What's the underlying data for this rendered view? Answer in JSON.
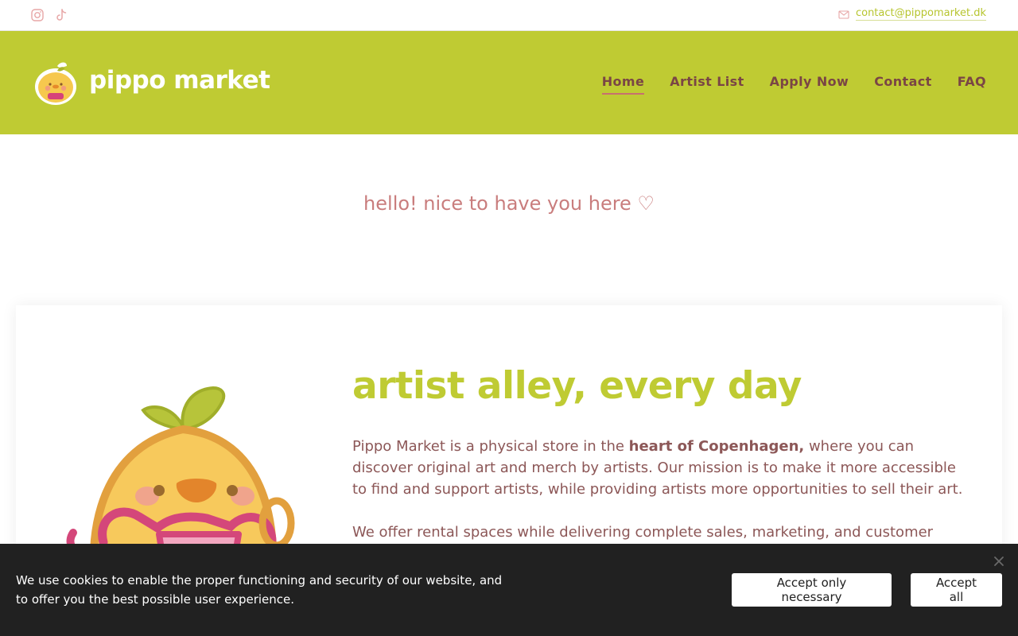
{
  "topbar": {
    "icons": [
      "instagram-icon",
      "tiktok-icon",
      "mail-icon"
    ],
    "email": "contact@pippomarket.dk"
  },
  "header": {
    "brand": "pippo market",
    "nav": [
      {
        "label": "Home",
        "active": true
      },
      {
        "label": "Artist List",
        "active": false
      },
      {
        "label": "Apply Now",
        "active": false
      },
      {
        "label": "Contact",
        "active": false
      },
      {
        "label": "FAQ",
        "active": false
      }
    ]
  },
  "greeting": "hello! nice to have you here ♡",
  "intro": {
    "title": "artist alley, every day",
    "p1_before": "Pippo Market is a physical store in the ",
    "p1_bold": "heart of Copenhagen,",
    "p1_after": " where you can discover original art and merch by artists. Our mission is to make it more accessible to find and support artists, while providing artists more opportunities to sell their art.",
    "p2": "We offer rental spaces while delivering complete sales, marketing, and customer support"
  },
  "cookie": {
    "text": "We use cookies to enable the proper functioning and security of our website, and to offer you the best possible user experience.",
    "accept_necessary": "Accept only necessary",
    "accept_all": "Accept all"
  },
  "colors": {
    "brand_green": "#bfcb33",
    "nav_text": "#7a4545",
    "greeting_pink": "#c97d7d",
    "body_text": "#8c5757",
    "cookie_bg": "#212121"
  }
}
